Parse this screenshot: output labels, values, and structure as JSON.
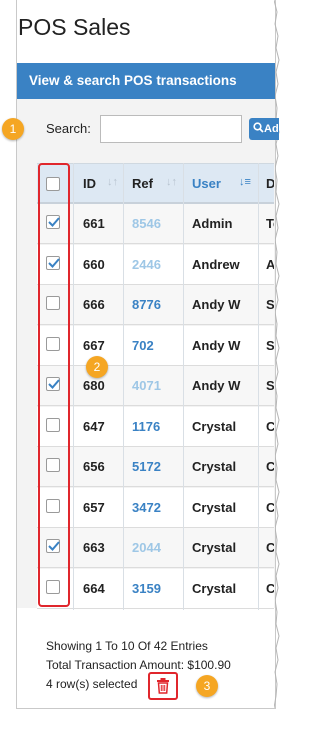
{
  "page": {
    "title": "POS Sales"
  },
  "panel": {
    "header": "View & search POS transactions"
  },
  "search": {
    "label": "Search:",
    "button_label": "Ad"
  },
  "table": {
    "columns": [
      "ID",
      "Ref",
      "User",
      "De"
    ],
    "rows": [
      {
        "checked": true,
        "id": "661",
        "ref": "8546",
        "user": "Admin",
        "desc": "Tec"
      },
      {
        "checked": true,
        "id": "660",
        "ref": "2446",
        "user": "Andrew",
        "desc": "An"
      },
      {
        "checked": false,
        "id": "666",
        "ref": "8776",
        "user": "Andy W",
        "desc": "So"
      },
      {
        "checked": false,
        "id": "667",
        "ref": "702",
        "user": "Andy W",
        "desc": "So"
      },
      {
        "checked": true,
        "id": "680",
        "ref": "4071",
        "user": "Andy W",
        "desc": "So"
      },
      {
        "checked": false,
        "id": "647",
        "ref": "1176",
        "user": "Crystal",
        "desc": "Cr"
      },
      {
        "checked": false,
        "id": "656",
        "ref": "5172",
        "user": "Crystal",
        "desc": "Cr"
      },
      {
        "checked": false,
        "id": "657",
        "ref": "3472",
        "user": "Crystal",
        "desc": "Cr"
      },
      {
        "checked": true,
        "id": "663",
        "ref": "2044",
        "user": "Crystal",
        "desc": "Cr"
      },
      {
        "checked": false,
        "id": "664",
        "ref": "3159",
        "user": "Crystal",
        "desc": "Cr"
      }
    ]
  },
  "footer": {
    "showing": "Showing 1 To 10 Of 42 Entries",
    "total": "Total Transaction Amount: $100.90",
    "selected": "4 row(s) selected"
  },
  "callouts": [
    "1",
    "2",
    "3"
  ],
  "colors": {
    "accent": "#3a82c4",
    "highlight": "#e0262c",
    "callout": "#f5a623",
    "delete": "#e0262c"
  }
}
